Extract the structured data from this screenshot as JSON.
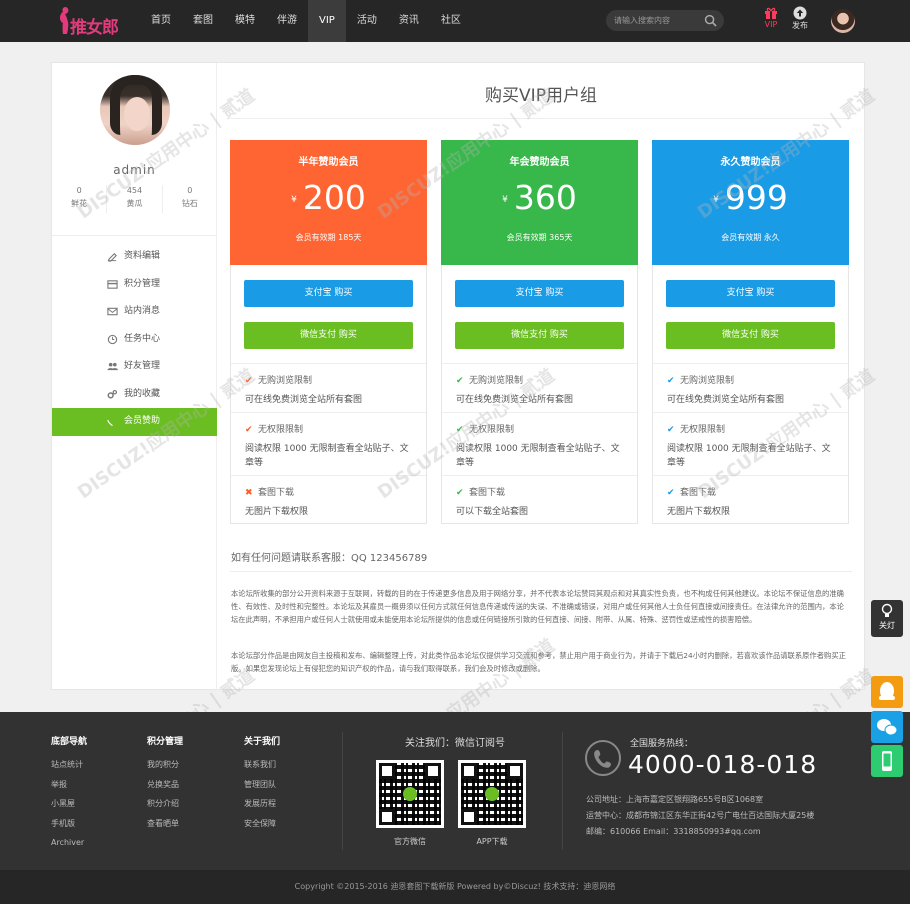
{
  "brand": {
    "logo_text": "推女郎"
  },
  "nav": {
    "items": [
      "首页",
      "套图",
      "模特",
      "伴游",
      "VIP",
      "活动",
      "资讯",
      "社区"
    ],
    "active_index": 4
  },
  "search": {
    "placeholder": "请输入搜索内容"
  },
  "top_right": {
    "vip_label": "VIP",
    "publish_label": "发布"
  },
  "sidebar": {
    "username": "admin",
    "stats": [
      {
        "value": "0",
        "label": "鲜花"
      },
      {
        "value": "454",
        "label": "黄瓜"
      },
      {
        "value": "0",
        "label": "钻石"
      }
    ],
    "menu": [
      {
        "label": "资料编辑",
        "icon": "edit-icon"
      },
      {
        "label": "积分管理",
        "icon": "card-icon"
      },
      {
        "label": "站内消息",
        "icon": "mail-icon"
      },
      {
        "label": "任务中心",
        "icon": "task-icon"
      },
      {
        "label": "好友管理",
        "icon": "users-icon"
      },
      {
        "label": "我的收藏",
        "icon": "cog-icon"
      },
      {
        "label": "会员赞助",
        "icon": "heart-icon"
      }
    ],
    "active_menu_index": 6
  },
  "page_title": "购买VIP用户组",
  "plans": [
    {
      "name": "半年赞助会员",
      "currency": "¥",
      "price": "200",
      "validity": "会员有效期 185天",
      "color": "#fe6533",
      "alipay_label": "支付宝 购买",
      "wechat_label": "微信支付 购买",
      "features": [
        {
          "title": "无购浏览限制",
          "desc": "可在线免费浏览全站所有套图",
          "mark": "✔",
          "mark_color": "#ff5a1f"
        },
        {
          "title": "无权限限制",
          "desc": "阅读权限 1000 无限制查看全站贴子、文章等",
          "mark": "✔",
          "mark_color": "#ff5a1f"
        },
        {
          "title": "套图下载",
          "desc": "无图片下载权限",
          "mark": "✖",
          "mark_color": "#ff5a1f"
        }
      ]
    },
    {
      "name": "年会赞助会员",
      "currency": "¥",
      "price": "360",
      "validity": "会员有效期 365天",
      "color": "#38b74a",
      "alipay_label": "支付宝 购买",
      "wechat_label": "微信支付 购买",
      "features": [
        {
          "title": "无购浏览限制",
          "desc": "可在线免费浏览全站所有套图",
          "mark": "✔",
          "mark_color": "#38b74a"
        },
        {
          "title": "无权限限制",
          "desc": "阅读权限 1000 无限制查看全站贴子、文章等",
          "mark": "✔",
          "mark_color": "#38b74a"
        },
        {
          "title": "套图下载",
          "desc": "可以下载全站套图",
          "mark": "✔",
          "mark_color": "#38b74a"
        }
      ]
    },
    {
      "name": "永久赞助会员",
      "currency": "¥",
      "price": "999",
      "validity": "会员有效期 永久",
      "color": "#1a9be6",
      "alipay_label": "支付宝 购买",
      "wechat_label": "微信支付 购买",
      "features": [
        {
          "title": "无购浏览限制",
          "desc": "可在线免费浏览全站所有套图",
          "mark": "✔",
          "mark_color": "#1a9be6"
        },
        {
          "title": "无权限限制",
          "desc": "阅读权限 1000 无限制查看全站贴子、文章等",
          "mark": "✔",
          "mark_color": "#1a9be6"
        },
        {
          "title": "套图下载",
          "desc": "无图片下载权限",
          "mark": "✔",
          "mark_color": "#1a9be6"
        }
      ]
    }
  ],
  "contact_line": "如有任何问题请联系客服：QQ 123456789",
  "disclaimer": [
    "本论坛所收集的部分公开资料来源于互联网，转载的目的在于传递更多信息及用于网络分享，并不代表本论坛赞同其观点和对其真实性负责，也不构成任何其他建议。本论坛不保证信息的准确性、有效性、及时性和完整性。本论坛及其雇员一概毋须以任何方式就任何信息传递或传送的失误、不准确或错误，对用户或任何其他人士负任何直接或间接责任。在法律允许的范围内，本论坛在此声明，不承担用户或任何人士就使用或未能使用本论坛所提供的信息或任何链接所引致的任何直接、间接、附带、从属、特殊、惩罚性或惩戒性的损害赔偿。",
    "本论坛部分作品是由网友自主投稿和发布、编辑整理上传，对此类作品本论坛仅提供学习交流和参考，禁止用户用于商业行为，并请于下载后24小时内删除，若喜欢该作品请联系原作者购买正版。如果您发现论坛上有侵犯您的知识产权的作品，请与我们取得联系，我们会及时修改或删除。"
  ],
  "footer": {
    "columns": [
      {
        "title": "底部导航",
        "items": [
          "站点统计",
          "举报",
          "小黑屋",
          "手机版",
          "Archiver"
        ]
      },
      {
        "title": "积分管理",
        "items": [
          "我的积分",
          "兑换奖品",
          "积分介绍",
          "查看晒单"
        ]
      },
      {
        "title": "关于我们",
        "items": [
          "联系我们",
          "管理团队",
          "发展历程",
          "安全保障"
        ]
      }
    ],
    "follow_title": "关注我们：微信订阅号",
    "qr_labels": [
      "官方微信",
      "APP下载"
    ],
    "hotline_label": "全国服务热线：",
    "hotline": "4000-018-018",
    "address_lines": [
      "公司地址：上海市嘉定区银翔路655号B区1068室",
      "运营中心：成都市锦江区东华正街42号广电仕百达国际大厦25楼",
      "邮编：610066 Email：3318850993#qq.com"
    ]
  },
  "copyright": "Copyright  ©2015-2016  迪恩套图下载新版  Powered by©Discuz!  技术支持：迪恩网络",
  "right_tools": {
    "light_label": "关灯"
  }
}
